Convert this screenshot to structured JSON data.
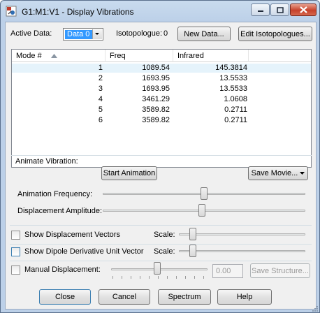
{
  "window": {
    "title": "G1:M1:V1 - Display Vibrations"
  },
  "top": {
    "active_data_label": "Active Data:",
    "active_data_value": "Data 0",
    "isotopologue_label": "Isotopologue:",
    "isotopologue_value": "0",
    "new_data_button": "New Data...",
    "edit_isotopologues_button": "Edit Isotopologues..."
  },
  "table": {
    "columns": [
      "Mode #",
      "Freq",
      "Infrared"
    ],
    "rows": [
      {
        "mode": "1",
        "freq": "1089.54",
        "ir": "145.3814"
      },
      {
        "mode": "2",
        "freq": "1693.95",
        "ir": "13.5533"
      },
      {
        "mode": "3",
        "freq": "1693.95",
        "ir": "13.5533"
      },
      {
        "mode": "4",
        "freq": "3461.29",
        "ir": "1.0608"
      },
      {
        "mode": "5",
        "freq": "3589.82",
        "ir": "0.2711"
      },
      {
        "mode": "6",
        "freq": "3589.82",
        "ir": "0.2711"
      }
    ]
  },
  "animate": {
    "group_label": "Animate Vibration:",
    "start_button": "Start Animation",
    "save_movie_button": "Save Movie...",
    "frequency_label": "Animation Frequency:",
    "frequency_level": 0.5,
    "amplitude_label": "Displacement Amplitude:",
    "amplitude_level": 0.49
  },
  "options": {
    "show_vectors_label": "Show Displacement Vectors",
    "show_vectors_checked": false,
    "vectors_scale_label": "Scale:",
    "vectors_scale_level": 0.09,
    "show_dipole_label": "Show Dipole Derivative Unit Vector",
    "show_dipole_checked": false,
    "dipole_scale_label": "Scale:",
    "dipole_scale_level": 0.09,
    "manual_label": "Manual Displacement:",
    "manual_checked": false,
    "manual_value": "0.00",
    "save_structure_button": "Save Structure..."
  },
  "bottom": {
    "close_button": "Close",
    "cancel_button": "Cancel",
    "spectrum_button": "Spectrum",
    "help_button": "Help"
  }
}
